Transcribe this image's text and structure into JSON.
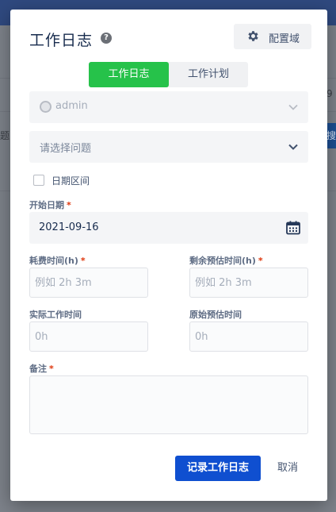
{
  "background": {
    "right_text_1": "9",
    "right_text_2": "搜",
    "left_text": "题"
  },
  "dialog": {
    "title": "工作日志",
    "config_label": "配置域",
    "tabs": [
      {
        "label": "工作日志",
        "active": true
      },
      {
        "label": "工作计划",
        "active": false
      }
    ],
    "user_select": {
      "value": "admin"
    },
    "issue_select": {
      "placeholder": "请选择问题"
    },
    "date_range": {
      "label": "日期区间",
      "checked": false
    },
    "start_date": {
      "label": "开始日期",
      "required": "*",
      "value": "2021-09-16"
    },
    "time_spent": {
      "label": "耗费时间(h)",
      "required": "*",
      "placeholder": "例如 2h 3m"
    },
    "remaining": {
      "label": "剩余预估时间(h)",
      "required": "*",
      "placeholder": "例如 2h 3m"
    },
    "actual_time": {
      "label": "实际工作时间",
      "placeholder": "0h"
    },
    "original_estimate": {
      "label": "原始预估时间",
      "placeholder": "0h"
    },
    "remark": {
      "label": "备注",
      "required": "*",
      "value": ""
    },
    "submit_label": "记录工作日志",
    "cancel_label": "取消"
  },
  "colors": {
    "active_tab": "#26c24a",
    "primary": "#0f4fd0",
    "required": "#de350b",
    "overlay": "#7d828a"
  },
  "icons": [
    "help-icon",
    "gear-icon",
    "chevron-down-icon",
    "calendar-icon",
    "user-avatar-icon"
  ]
}
